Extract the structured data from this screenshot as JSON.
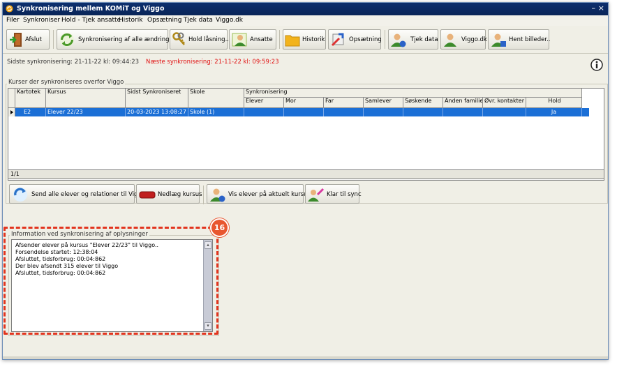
{
  "window": {
    "title": "Synkronisering mellem KOMiT og Viggo",
    "minimize": "–",
    "close": "×"
  },
  "menu": [
    "Filer",
    "Synkroniser",
    "Hold - Tjek ansatte",
    "Historik",
    "Opsætning",
    "Tjek data",
    "Viggo.dk"
  ],
  "toolbar": {
    "afslut": "Afslut",
    "sync_all": "Synkronisering af alle ændringer",
    "hold_laasning": "Hold låsning..",
    "ansatte": "Ansatte",
    "historik": "Historik",
    "opsaetning": "Opsætning",
    "tjek_data": "Tjek data",
    "viggo_dk": "Viggo.dk",
    "hent_billeder": "Hent billeder.."
  },
  "status": {
    "last_sync": "Sidste synkronisering: 21-11-22 kl: 09:44:23",
    "next_sync": "Næste synkronisering: 21-11-22 kl: 09:59:23"
  },
  "courses": {
    "group_label": "Kurser der synkroniseres overfor Viggo",
    "columns": {
      "kartotek": "Kartotek",
      "kursus": "Kursus",
      "sidst": "Sidst Synkroniseret",
      "skole": "Skole",
      "synkronisering": "Synkronisering",
      "elever": "Elever",
      "mor": "Mor",
      "far": "Far",
      "samlever": "Samlever",
      "soeskende": "Søskende",
      "anden_familie": "Anden familie",
      "oevr_kontakter": "Øvr. kontakter",
      "hold": "Hold"
    },
    "rows": [
      {
        "kartotek": "E2",
        "kursus": "Elever 22/23",
        "sidst": "20-03-2023 13:08:27",
        "skole": "Skole (1)",
        "elever": "",
        "mor": "",
        "far": "",
        "samlever": "",
        "soeskende": "",
        "anden_familie": "",
        "oevr_kontakter": "",
        "hold": "Ja"
      }
    ],
    "footer": "1/1"
  },
  "actions": {
    "send_all": "Send alle elever og relationer til Viggo",
    "nedlaeg": "Nedlæg kursus",
    "vis_elever": "Vis elever på aktuelt kursus",
    "klar_til_sync": "Klar til sync"
  },
  "info": {
    "group_label": "Information ved synkronisering af oplysninger",
    "lines": [
      "Afsender elever på kursus \"Elever 22/23\" til Viggo..",
      "Forsendelse startet: 12:38:04",
      "Afsluttet, tidsforbrug: 00:04:862",
      "Der blev afsendt 315 elever til Viggo",
      "Afsluttet, tidsforbrug: 00:04:862"
    ]
  },
  "callout": "16",
  "colors": {
    "titlebar": "#0c2f6e",
    "selection": "#1b6fd6",
    "callout": "#e8562f",
    "next_sync": "#e01010"
  }
}
